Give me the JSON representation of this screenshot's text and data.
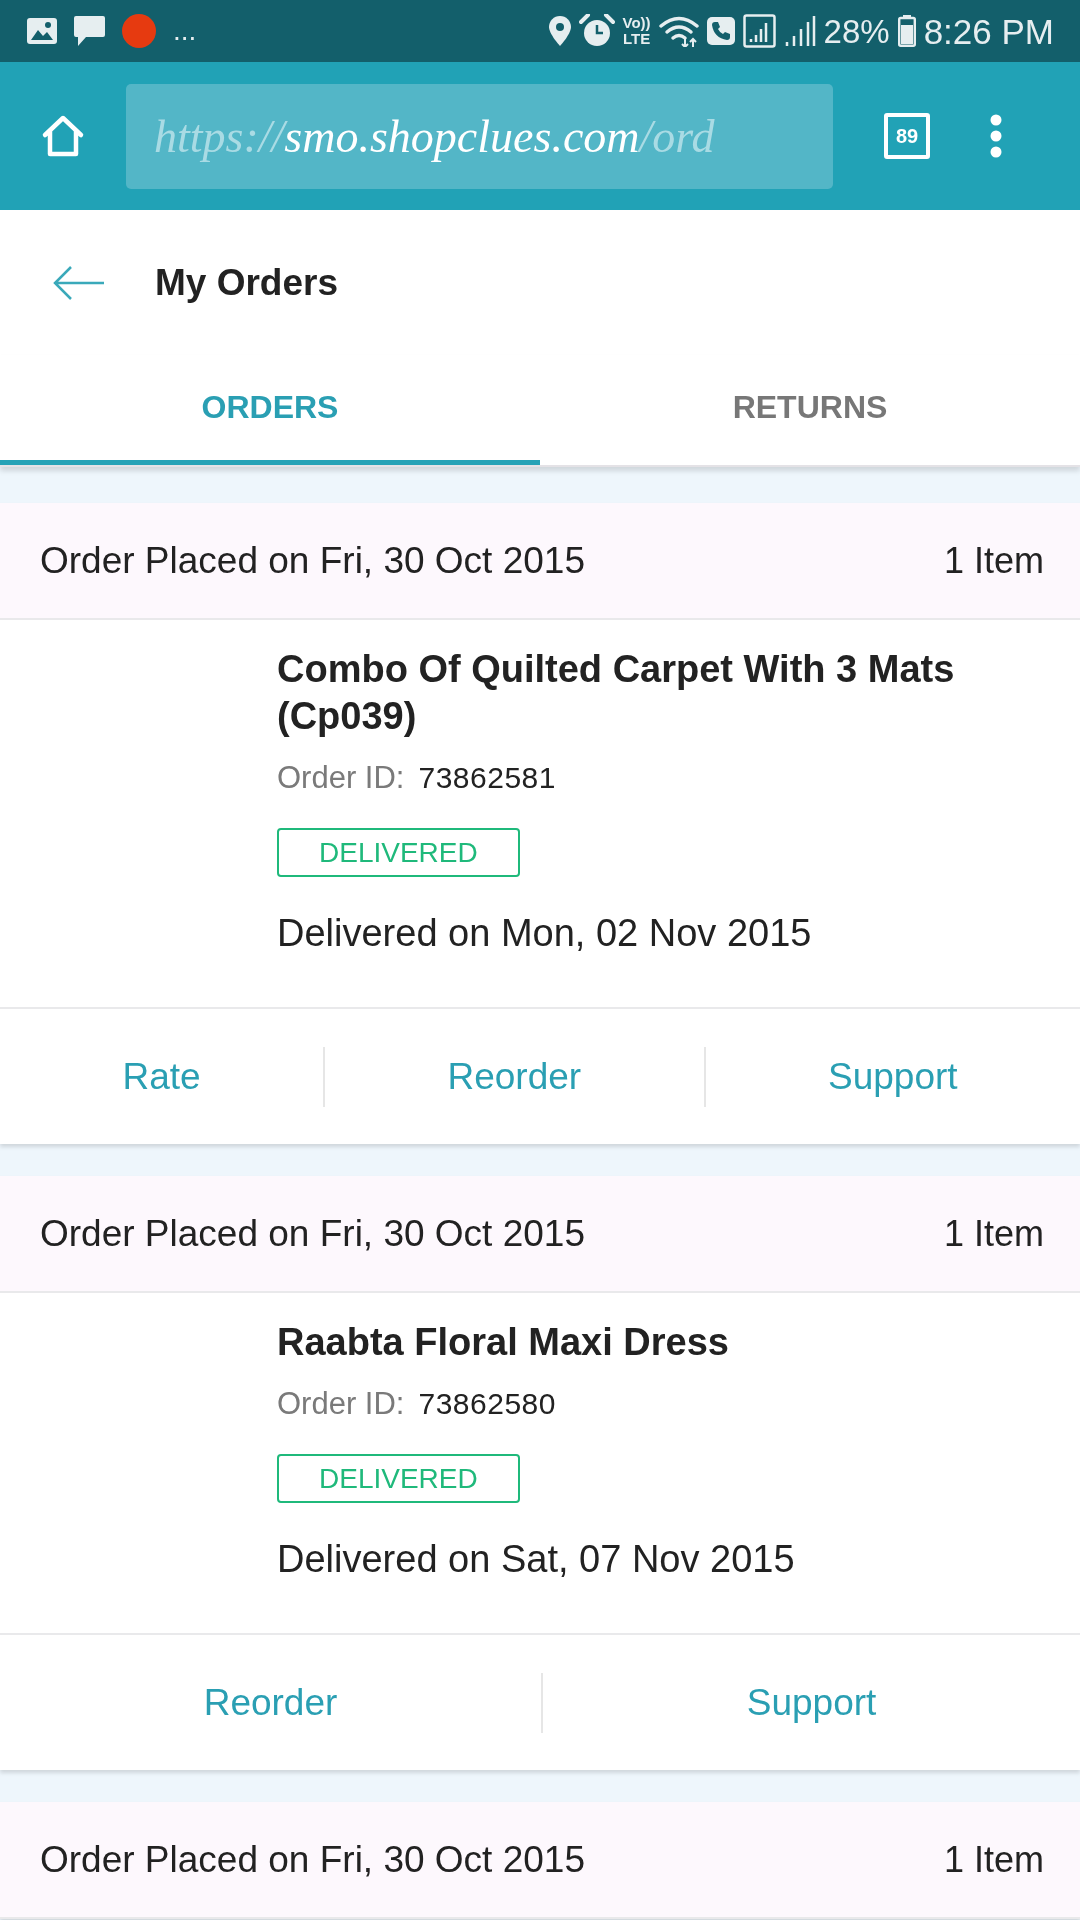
{
  "status_bar": {
    "notifications_more": "...",
    "volte_top": "Vo))",
    "volte_bottom": "LTE",
    "battery": "28%",
    "time": "8:26 PM"
  },
  "browser": {
    "url": {
      "scheme": "https://",
      "host": "smo.shopclues.com",
      "path": "/ord"
    },
    "tab_count": "89"
  },
  "header": {
    "title": "My Orders"
  },
  "tabs": [
    {
      "label": "ORDERS",
      "selected": true
    },
    {
      "label": "RETURNS",
      "selected": false
    }
  ],
  "orders": [
    {
      "placed": "Order Placed on Fri, 30 Oct 2015",
      "items": "1 Item",
      "title": "Combo Of Quilted Carpet With 3 Mats (Cp039)",
      "order_id_label": "Order ID:",
      "order_id": "73862581",
      "status": "DELIVERED",
      "delivered": "Delivered on Mon, 02 Nov 2015",
      "actions": [
        "Rate",
        "Reorder",
        "Support"
      ]
    },
    {
      "placed": "Order Placed on Fri, 30 Oct 2015",
      "items": "1 Item",
      "title": "Raabta Floral Maxi Dress",
      "order_id_label": "Order ID:",
      "order_id": "73862580",
      "status": "DELIVERED",
      "delivered": "Delivered on Sat, 07 Nov 2015",
      "actions": [
        "Reorder",
        "Support"
      ]
    },
    {
      "placed": "Order Placed on Fri, 30 Oct 2015",
      "items": "1 Item"
    }
  ]
}
